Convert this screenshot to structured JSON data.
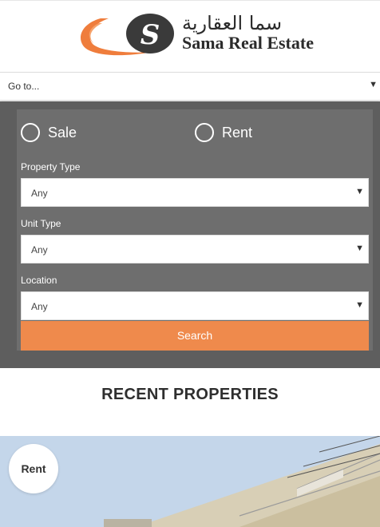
{
  "header": {
    "logo_ar": "سما العقارية",
    "logo_en": "Sama Real Estate",
    "brand_colors": {
      "orange": "#ef8a4c",
      "dark": "#2b2b2b"
    }
  },
  "nav": {
    "goto_label": "Go to...",
    "arrow_icon": "caret-down-icon"
  },
  "search": {
    "listing_options": [
      {
        "label": "Sale",
        "selected": false
      },
      {
        "label": "Rent",
        "selected": false
      }
    ],
    "fields": [
      {
        "label": "Property Type",
        "value": "Any"
      },
      {
        "label": "Unit Type",
        "value": "Any"
      },
      {
        "label": "Location",
        "value": "Any"
      }
    ],
    "button_label": "Search",
    "button_color": "#ef8a4c"
  },
  "recent": {
    "title": "RECENT PROPERTIES",
    "first_card": {
      "badge": "Rent"
    }
  }
}
